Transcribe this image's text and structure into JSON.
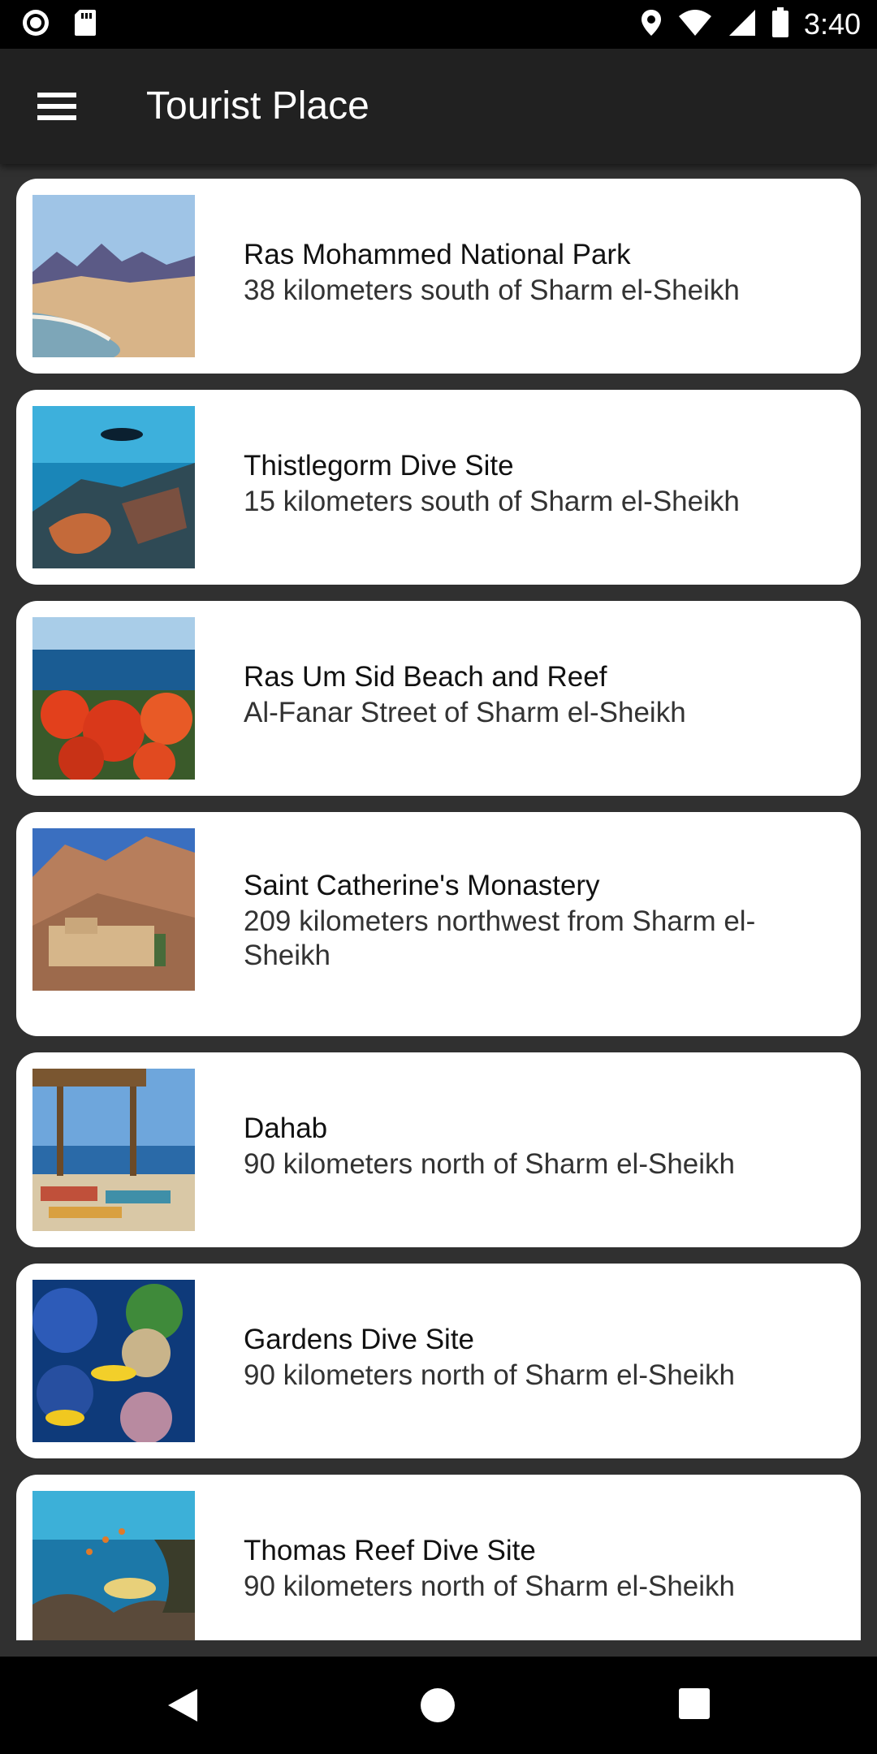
{
  "status_bar": {
    "time": "3:40",
    "icons": [
      "record-icon",
      "sd-card-icon",
      "location-icon",
      "wifi-icon",
      "cell-signal-icon",
      "battery-icon"
    ]
  },
  "app_bar": {
    "menu_icon": "hamburger-menu-icon",
    "title": "Tourist Place"
  },
  "places": [
    {
      "name": "Ras Mohammed National Park",
      "location": "38 kilometers south of Sharm el-Sheikh"
    },
    {
      "name": "Thistlegorm Dive Site",
      "location": "15 kilometers south of Sharm el-Sheikh"
    },
    {
      "name": "Ras Um Sid Beach and Reef",
      "location": "Al-Fanar Street of Sharm el-Sheikh"
    },
    {
      "name": "Saint Catherine's Monastery",
      "location": "209 kilometers northwest from Sharm el-Sheikh"
    },
    {
      "name": "Dahab",
      "location": "90 kilometers north of Sharm el-Sheikh"
    },
    {
      "name": "Gardens Dive Site",
      "location": "90 kilometers north of Sharm el-Sheikh"
    },
    {
      "name": "Thomas Reef Dive Site",
      "location": "90 kilometers north of Sharm el-Sheikh"
    }
  ],
  "nav_bar": {
    "icons": [
      "back-triangle-icon",
      "home-circle-icon",
      "recents-square-icon"
    ]
  },
  "colors": {
    "status_bar": "#000000",
    "app_bar": "#212121",
    "background": "#303030",
    "card": "#ffffff"
  }
}
